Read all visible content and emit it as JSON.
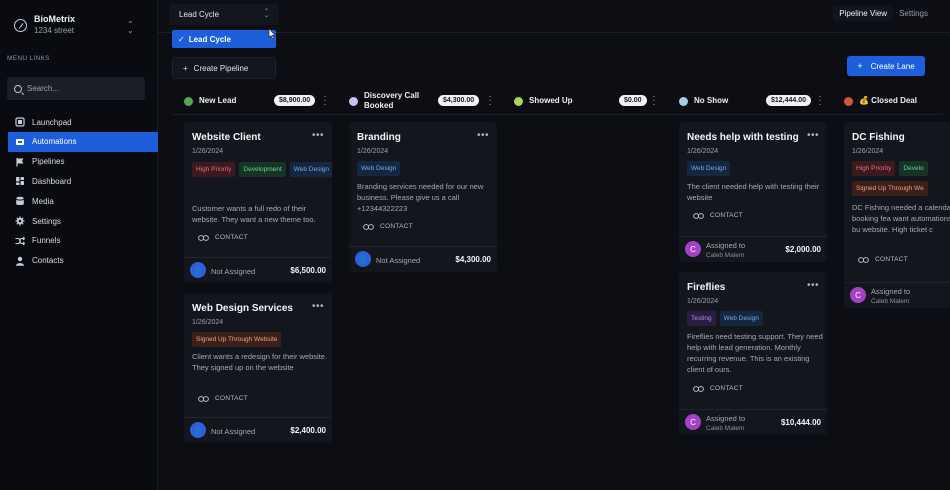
{
  "brand": {
    "name": "BioMetrix",
    "subtitle": "1234 street",
    "switch_icon": "chevron-up-down-icon"
  },
  "sidebar": {
    "caption": "MENU LINKS",
    "search_placeholder": "Search...",
    "items": [
      {
        "label": "Launchpad",
        "icon": "rocket-icon"
      },
      {
        "label": "Automations",
        "icon": "bolt-icon",
        "active": true
      },
      {
        "label": "Pipelines",
        "icon": "flag-icon"
      },
      {
        "label": "Dashboard",
        "icon": "grid-icon"
      },
      {
        "label": "Media",
        "icon": "database-icon"
      },
      {
        "label": "Settings",
        "icon": "gear-icon"
      },
      {
        "label": "Funnels",
        "icon": "funnel-icon"
      },
      {
        "label": "Contacts",
        "icon": "person-icon"
      }
    ]
  },
  "topbar": {
    "pipeline_select": "Lead Cycle",
    "tabs": [
      "Pipeline View",
      "Settings"
    ]
  },
  "dropdown": {
    "selected": "Lead Cycle",
    "create_label": "Create Pipeline"
  },
  "create_lane_label": "Create Lane",
  "lanes": [
    {
      "title": "New Lead",
      "amount": "$8,900.00",
      "dot_color": "#5aa84d",
      "cards": [
        {
          "title": "Website Client",
          "date": "1/26/2024",
          "tags": [
            "High Priority",
            "Development",
            "Web Design"
          ],
          "desc": "Customer wants a full redo of their website. They want a new theme too.",
          "contact": "CONTACT",
          "assignee": "Not Assigned",
          "amount": "$6,500.00"
        },
        {
          "title": "Web Design Services",
          "date": "1/26/2024",
          "tags": [
            "Signed Up Through Website"
          ],
          "desc": "Client wants a redesign for their website. They signed up on the website",
          "contact": "CONTACT",
          "assignee": "Not Assigned",
          "amount": "$2,400.00"
        }
      ]
    },
    {
      "title": "Discovery Call Booked",
      "amount": "$4,300.00",
      "dot_color": "#c9c2ee",
      "cards": [
        {
          "title": "Branding",
          "date": "1/26/2024",
          "tags": [
            "Web Design"
          ],
          "desc": "Branding services needed for our new business. Please give us a call +12344322223",
          "contact": "CONTACT",
          "assignee": "Not Assigned",
          "amount": "$4,300.00"
        }
      ]
    },
    {
      "title": "Showed Up",
      "amount": "$0.00",
      "dot_color": "#a9d65a",
      "cards": []
    },
    {
      "title": "No Show",
      "amount": "$12,444.00",
      "dot_color": "#a8cbe6",
      "cards": [
        {
          "title": "Needs help with testing",
          "date": "1/26/2024",
          "tags": [
            "Web Design"
          ],
          "desc": "The client needed help with testing their website",
          "contact": "CONTACT",
          "assigned_label": "Assigned to",
          "assignee": "Caleb Malem",
          "avatar": "C",
          "amount": "$2,000.00"
        },
        {
          "title": "Fireflies",
          "date": "1/26/2024",
          "tags": [
            "Testing",
            "Web Design"
          ],
          "desc": "Fireflies need testing support. They need help with lead generation. Monthly recurring revenue. This is an existing client of ours.",
          "contact": "CONTACT",
          "assigned_label": "Assigned to",
          "assignee": "Caleb Malem",
          "avatar": "C",
          "amount": "$10,444.00"
        }
      ]
    },
    {
      "title": "💰 Closed Deal",
      "dot_color": "#d4573a",
      "cards": [
        {
          "title": "DC Fishing",
          "date": "1/26/2024",
          "tags": [
            "High Priority",
            "Develo",
            "Signed Up Through We"
          ],
          "desc": "DC Fishing needed a calendar booking fea want automations bu website. High ticket c",
          "contact": "CONTACT",
          "assigned_label": "Assigned to",
          "assignee": "Caleb Malem",
          "avatar": "C"
        }
      ]
    }
  ],
  "colors": {
    "accent": "#1d5fdb",
    "background": "#0c0e13",
    "card": "#14161d"
  }
}
